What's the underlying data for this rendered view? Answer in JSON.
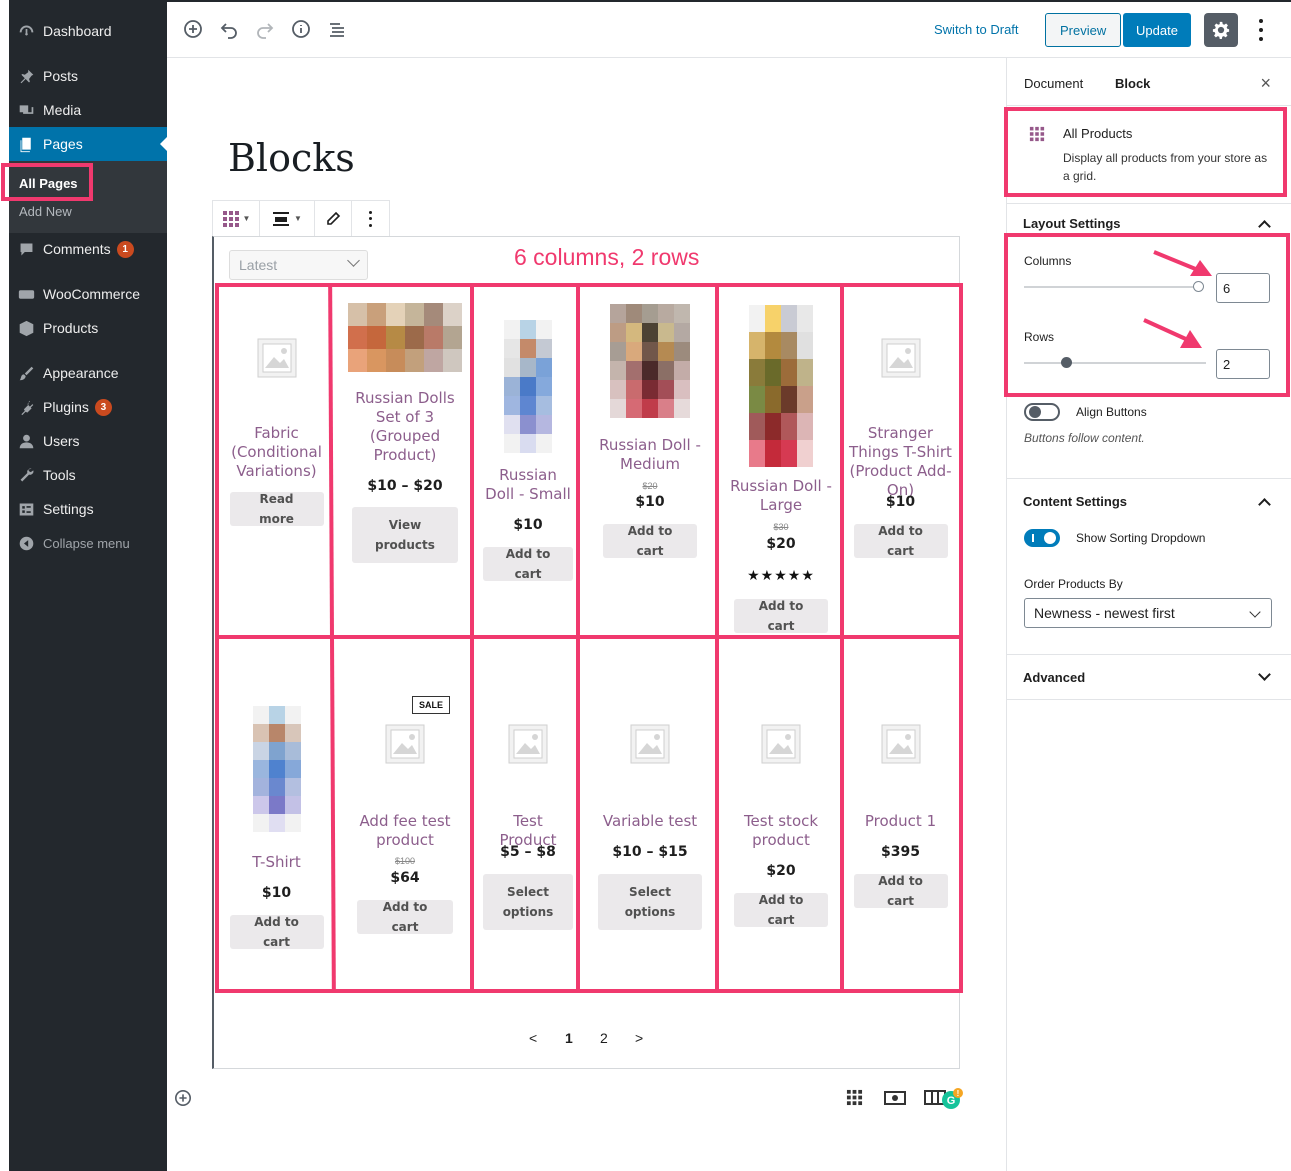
{
  "sidebar": {
    "items": [
      {
        "label": "Dashboard",
        "icon": "dashboard-icon"
      },
      {
        "label": "Posts",
        "icon": "pin-icon"
      },
      {
        "label": "Media",
        "icon": "media-icon"
      },
      {
        "label": "Pages",
        "icon": "pages-icon"
      },
      {
        "label": "Comments",
        "icon": "comment-icon",
        "badge": "1"
      },
      {
        "label": "WooCommerce",
        "icon": "woocommerce-icon"
      },
      {
        "label": "Products",
        "icon": "products-icon"
      },
      {
        "label": "Appearance",
        "icon": "brush-icon"
      },
      {
        "label": "Plugins",
        "icon": "plug-icon",
        "badge": "3"
      },
      {
        "label": "Users",
        "icon": "user-icon"
      },
      {
        "label": "Tools",
        "icon": "wrench-icon"
      },
      {
        "label": "Settings",
        "icon": "settings-icon"
      },
      {
        "label": "Collapse menu",
        "icon": "collapse-icon"
      }
    ],
    "submenu": [
      "All Pages",
      "Add New"
    ]
  },
  "topbar": {
    "switch_to_draft": "Switch to Draft",
    "preview": "Preview",
    "update": "Update"
  },
  "editor": {
    "page_title": "Blocks",
    "sort_select": "Latest",
    "annotation": "6 columns, 2 rows",
    "pager": {
      "prev": "<",
      "page1": "1",
      "page2": "2",
      "next": ">"
    }
  },
  "products": [
    {
      "name": "Fabric (Conditional Variations)",
      "price": "",
      "old_price": "",
      "button": "Read more",
      "image": "placeholder"
    },
    {
      "name": "Russian Dolls Set of 3 (Grouped Product)",
      "price": "$10 – $20",
      "old_price": "",
      "button": "View products",
      "image": "dolls"
    },
    {
      "name": "Russian Doll - Small",
      "price": "$10",
      "old_price": "",
      "button": "Add to cart",
      "image": "doll-small"
    },
    {
      "name": "Russian Doll - Medium",
      "price": "$10",
      "old_price": "$20",
      "button": "Add to cart",
      "image": "doll-medium"
    },
    {
      "name": "Russian Doll - Large",
      "price": "$20",
      "old_price": "$30",
      "button": "Add to cart",
      "image": "doll-large",
      "stars": "★★★★★"
    },
    {
      "name": "Stranger Things T-Shirt (Product Add-On)",
      "price": "$10",
      "old_price": "",
      "button": "Add to cart",
      "image": "placeholder"
    },
    {
      "name": "T-Shirt",
      "price": "$10",
      "old_price": "",
      "button": "Add to cart",
      "image": "tshirt"
    },
    {
      "name": "Add fee test product",
      "price": "$64",
      "old_price": "$100",
      "button": "Add to cart",
      "image": "placeholder",
      "badge": "SALE"
    },
    {
      "name": "Test Product",
      "price": "$5 – $8",
      "old_price": "",
      "button": "Select options",
      "image": "placeholder"
    },
    {
      "name": "Variable test",
      "price": "$10 – $15",
      "old_price": "",
      "button": "Select options",
      "image": "placeholder"
    },
    {
      "name": "Test stock product",
      "price": "$20",
      "old_price": "",
      "button": "Add to cart",
      "image": "placeholder"
    },
    {
      "name": "Product 1",
      "price": "$395",
      "old_price": "",
      "button": "Add to cart",
      "image": "placeholder"
    }
  ],
  "inspector": {
    "tab_document": "Document",
    "tab_block": "Block",
    "close": "×",
    "block_name": "All Products",
    "block_desc": "Display all products from your store as a grid.",
    "layout_title": "Layout Settings",
    "columns_label": "Columns",
    "columns_value": "6",
    "rows_label": "Rows",
    "rows_value": "2",
    "align_label": "Align Buttons",
    "align_help": "Buttons follow content.",
    "content_title": "Content Settings",
    "sorting_label": "Show Sorting Dropdown",
    "order_label": "Order Products By",
    "order_value": "Newness - newest first",
    "advanced_title": "Advanced"
  },
  "colors": {
    "accent": "#f0396e",
    "primary": "#007cba",
    "product_link": "#8c5e8c",
    "admin_bg": "#23282d"
  }
}
